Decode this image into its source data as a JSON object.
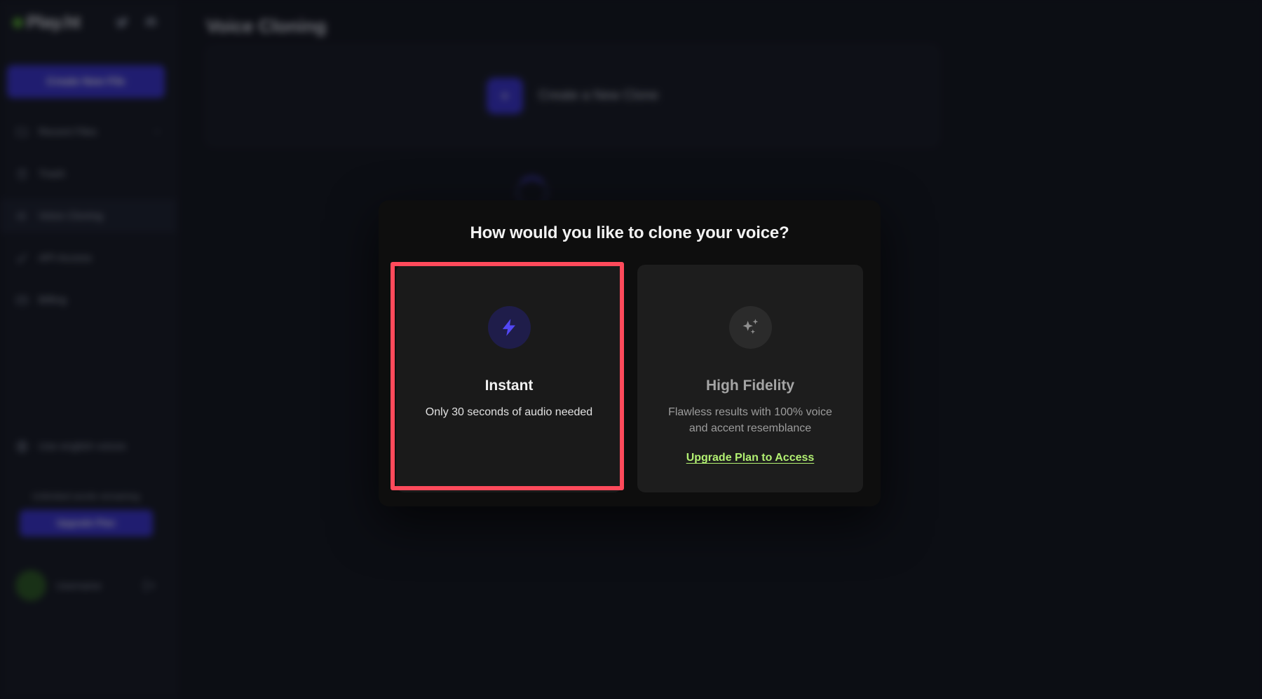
{
  "app": {
    "brand": "Play.ht",
    "brand_dot_color": "#55a830"
  },
  "sidebar": {
    "social": [
      {
        "name": "twitter-icon",
        "label": "Twitter"
      },
      {
        "name": "discord-icon",
        "label": "Discord"
      }
    ],
    "new_file_button": "Create New File",
    "items": [
      {
        "label": "Recent Files",
        "icon": "folder-icon",
        "active": false,
        "has_caret": true
      },
      {
        "label": "Trash",
        "icon": "trash-icon",
        "active": false,
        "has_caret": false
      },
      {
        "label": "Voice Cloning",
        "icon": "voice-icon",
        "active": true,
        "has_caret": false
      },
      {
        "label": "API Access",
        "icon": "key-icon",
        "active": false,
        "has_caret": false
      },
      {
        "label": "Billing",
        "icon": "card-icon",
        "active": false,
        "has_caret": false
      }
    ],
    "dark_mode_label": "Use english voices",
    "promo": {
      "text": "Unlimited words remaining",
      "button": "Upgrade Plan"
    },
    "user": {
      "name": "Username",
      "logout_icon": "logout-icon"
    }
  },
  "main": {
    "page_title": "Voice Cloning",
    "create_clone_card": {
      "label": "Create a New Clone",
      "icon": "plus-square-icon"
    },
    "loading_spinner": "loading-spinner"
  },
  "modal": {
    "title": "How would you like to clone your voice?",
    "options": [
      {
        "id": "instant",
        "icon": "lightning-bolt-icon",
        "title": "Instant",
        "description": "Only 30 seconds of audio needed",
        "link": null,
        "selected": true,
        "icon_color": "#5247f5",
        "icon_bg": "#1f1d4a"
      },
      {
        "id": "high-fidelity",
        "icon": "sparkles-icon",
        "title": "High Fidelity",
        "description": "Flawless results with 100% voice and accent resemblance",
        "link": "Upgrade Plan to Access",
        "selected": false,
        "icon_color": "#8f8f8f",
        "icon_bg": "#2b2b2b"
      }
    ]
  },
  "highlight": {
    "target": "instant-option-card",
    "border_color": "#ff4a5b"
  },
  "colors": {
    "accent_purple": "#3b35d6",
    "link_green": "#b2f072",
    "highlight_red": "#ff4a5b",
    "modal_bg": "#0e0e0e",
    "app_bg": "#13161f"
  }
}
